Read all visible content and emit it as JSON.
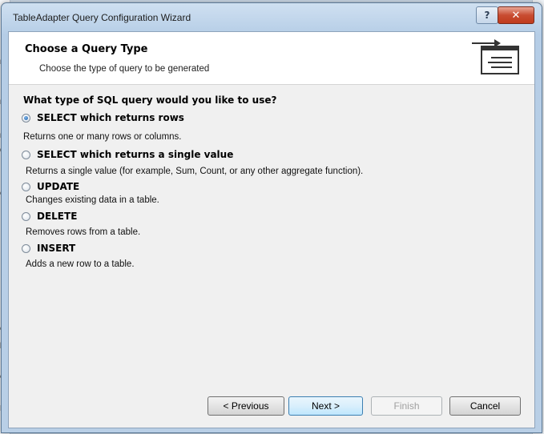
{
  "window": {
    "title": "TableAdapter Query Configuration Wizard"
  },
  "header": {
    "title": "Choose a Query Type",
    "subtitle": "Choose the type of query to be generated"
  },
  "question": "What type of SQL query would you like to use?",
  "options": [
    {
      "label": "SELECT which returns rows",
      "description": "Returns one or many rows or columns.",
      "selected": true
    },
    {
      "label": "SELECT which returns a single value",
      "description": "Returns a single value (for example, Sum, Count, or any other aggregate function).",
      "selected": false
    },
    {
      "label": "UPDATE",
      "description": "Changes existing data in a table.",
      "selected": false
    },
    {
      "label": "DELETE",
      "description": "Removes rows from a table.",
      "selected": false
    },
    {
      "label": "INSERT",
      "description": "Adds a new row to a table.",
      "selected": false
    }
  ],
  "buttons": {
    "previous": "< Previous",
    "next": "Next >",
    "finish": "Finish",
    "cancel": "Cancel"
  },
  "icons": {
    "help": "help-icon",
    "close": "close-icon",
    "header_graphic": "query-wizard-icon"
  },
  "colors": {
    "accent": "#3c7fb1",
    "close": "#c84c31"
  }
}
